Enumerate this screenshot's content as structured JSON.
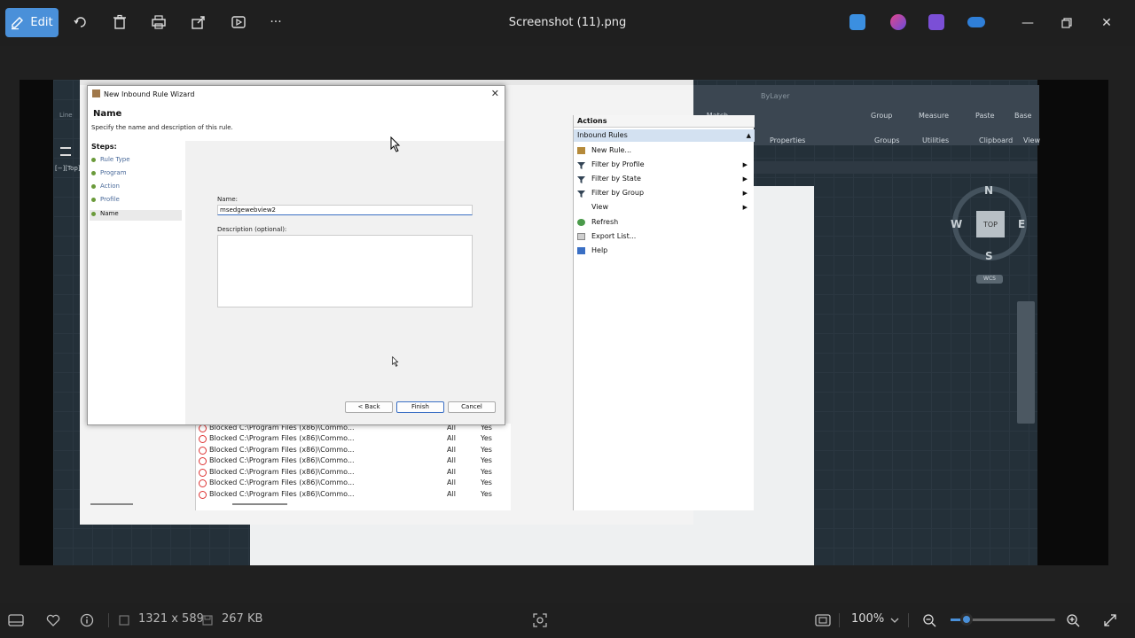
{
  "toolbar": {
    "edit_label": "Edit",
    "title": "Screenshot (11).png",
    "more_label": "···"
  },
  "cad": {
    "ribbon_properties": "Properties",
    "ribbon_groups": "Groups",
    "ribbon_utilities": "Utilities",
    "ribbon_clipboard": "Clipboard",
    "ribbon_view": "View",
    "ribbon_match": "Match Properties",
    "ribbon_bylayer": "ByLayer",
    "ribbon_group": "Group",
    "ribbon_measure": "Measure",
    "ribbon_paste": "Paste",
    "ribbon_base": "Base",
    "viewport_label": "[−][Top]",
    "line_label": "Line",
    "compass": {
      "n": "N",
      "s": "S",
      "e": "E",
      "w": "W",
      "top": "TOP",
      "wcs": "WCS"
    }
  },
  "wizard": {
    "title": "New Inbound Rule Wizard",
    "heading": "Name",
    "description": "Specify the name and description of this rule.",
    "steps_label": "Steps:",
    "steps": [
      "Rule Type",
      "Program",
      "Action",
      "Profile",
      "Name"
    ],
    "name_label": "Name:",
    "name_value": "msedgewebview2",
    "desc_label": "Description (optional):",
    "back": "< Back",
    "finish": "Finish",
    "cancel": "Cancel"
  },
  "actions": {
    "header": "Actions",
    "section": "Inbound Rules",
    "items": [
      "New Rule...",
      "Filter by Profile",
      "Filter by State",
      "Filter by Group",
      "View",
      "Refresh",
      "Export List...",
      "Help"
    ]
  },
  "rules": {
    "rows": [
      {
        "name": "Blocked C:\\Program Files (x86)\\Commo...",
        "profile": "All",
        "enabled": "Yes"
      },
      {
        "name": "Blocked C:\\Program Files (x86)\\Commo...",
        "profile": "All",
        "enabled": "Yes"
      },
      {
        "name": "Blocked C:\\Program Files (x86)\\Commo...",
        "profile": "All",
        "enabled": "Yes"
      },
      {
        "name": "Blocked C:\\Program Files (x86)\\Commo...",
        "profile": "All",
        "enabled": "Yes"
      },
      {
        "name": "Blocked C:\\Program Files (x86)\\Commo...",
        "profile": "All",
        "enabled": "Yes"
      },
      {
        "name": "Blocked C:\\Program Files (x86)\\Commo...",
        "profile": "All",
        "enabled": "Yes"
      },
      {
        "name": "Blocked C:\\Program Files (x86)\\Commo...",
        "profile": "All",
        "enabled": "Yes"
      }
    ]
  },
  "status": {
    "dimensions": "1321 x 589",
    "size": "267 KB",
    "zoom": "100%",
    "zoom_fraction": 0.15
  },
  "colors": {
    "accent": "#4a90d9"
  }
}
